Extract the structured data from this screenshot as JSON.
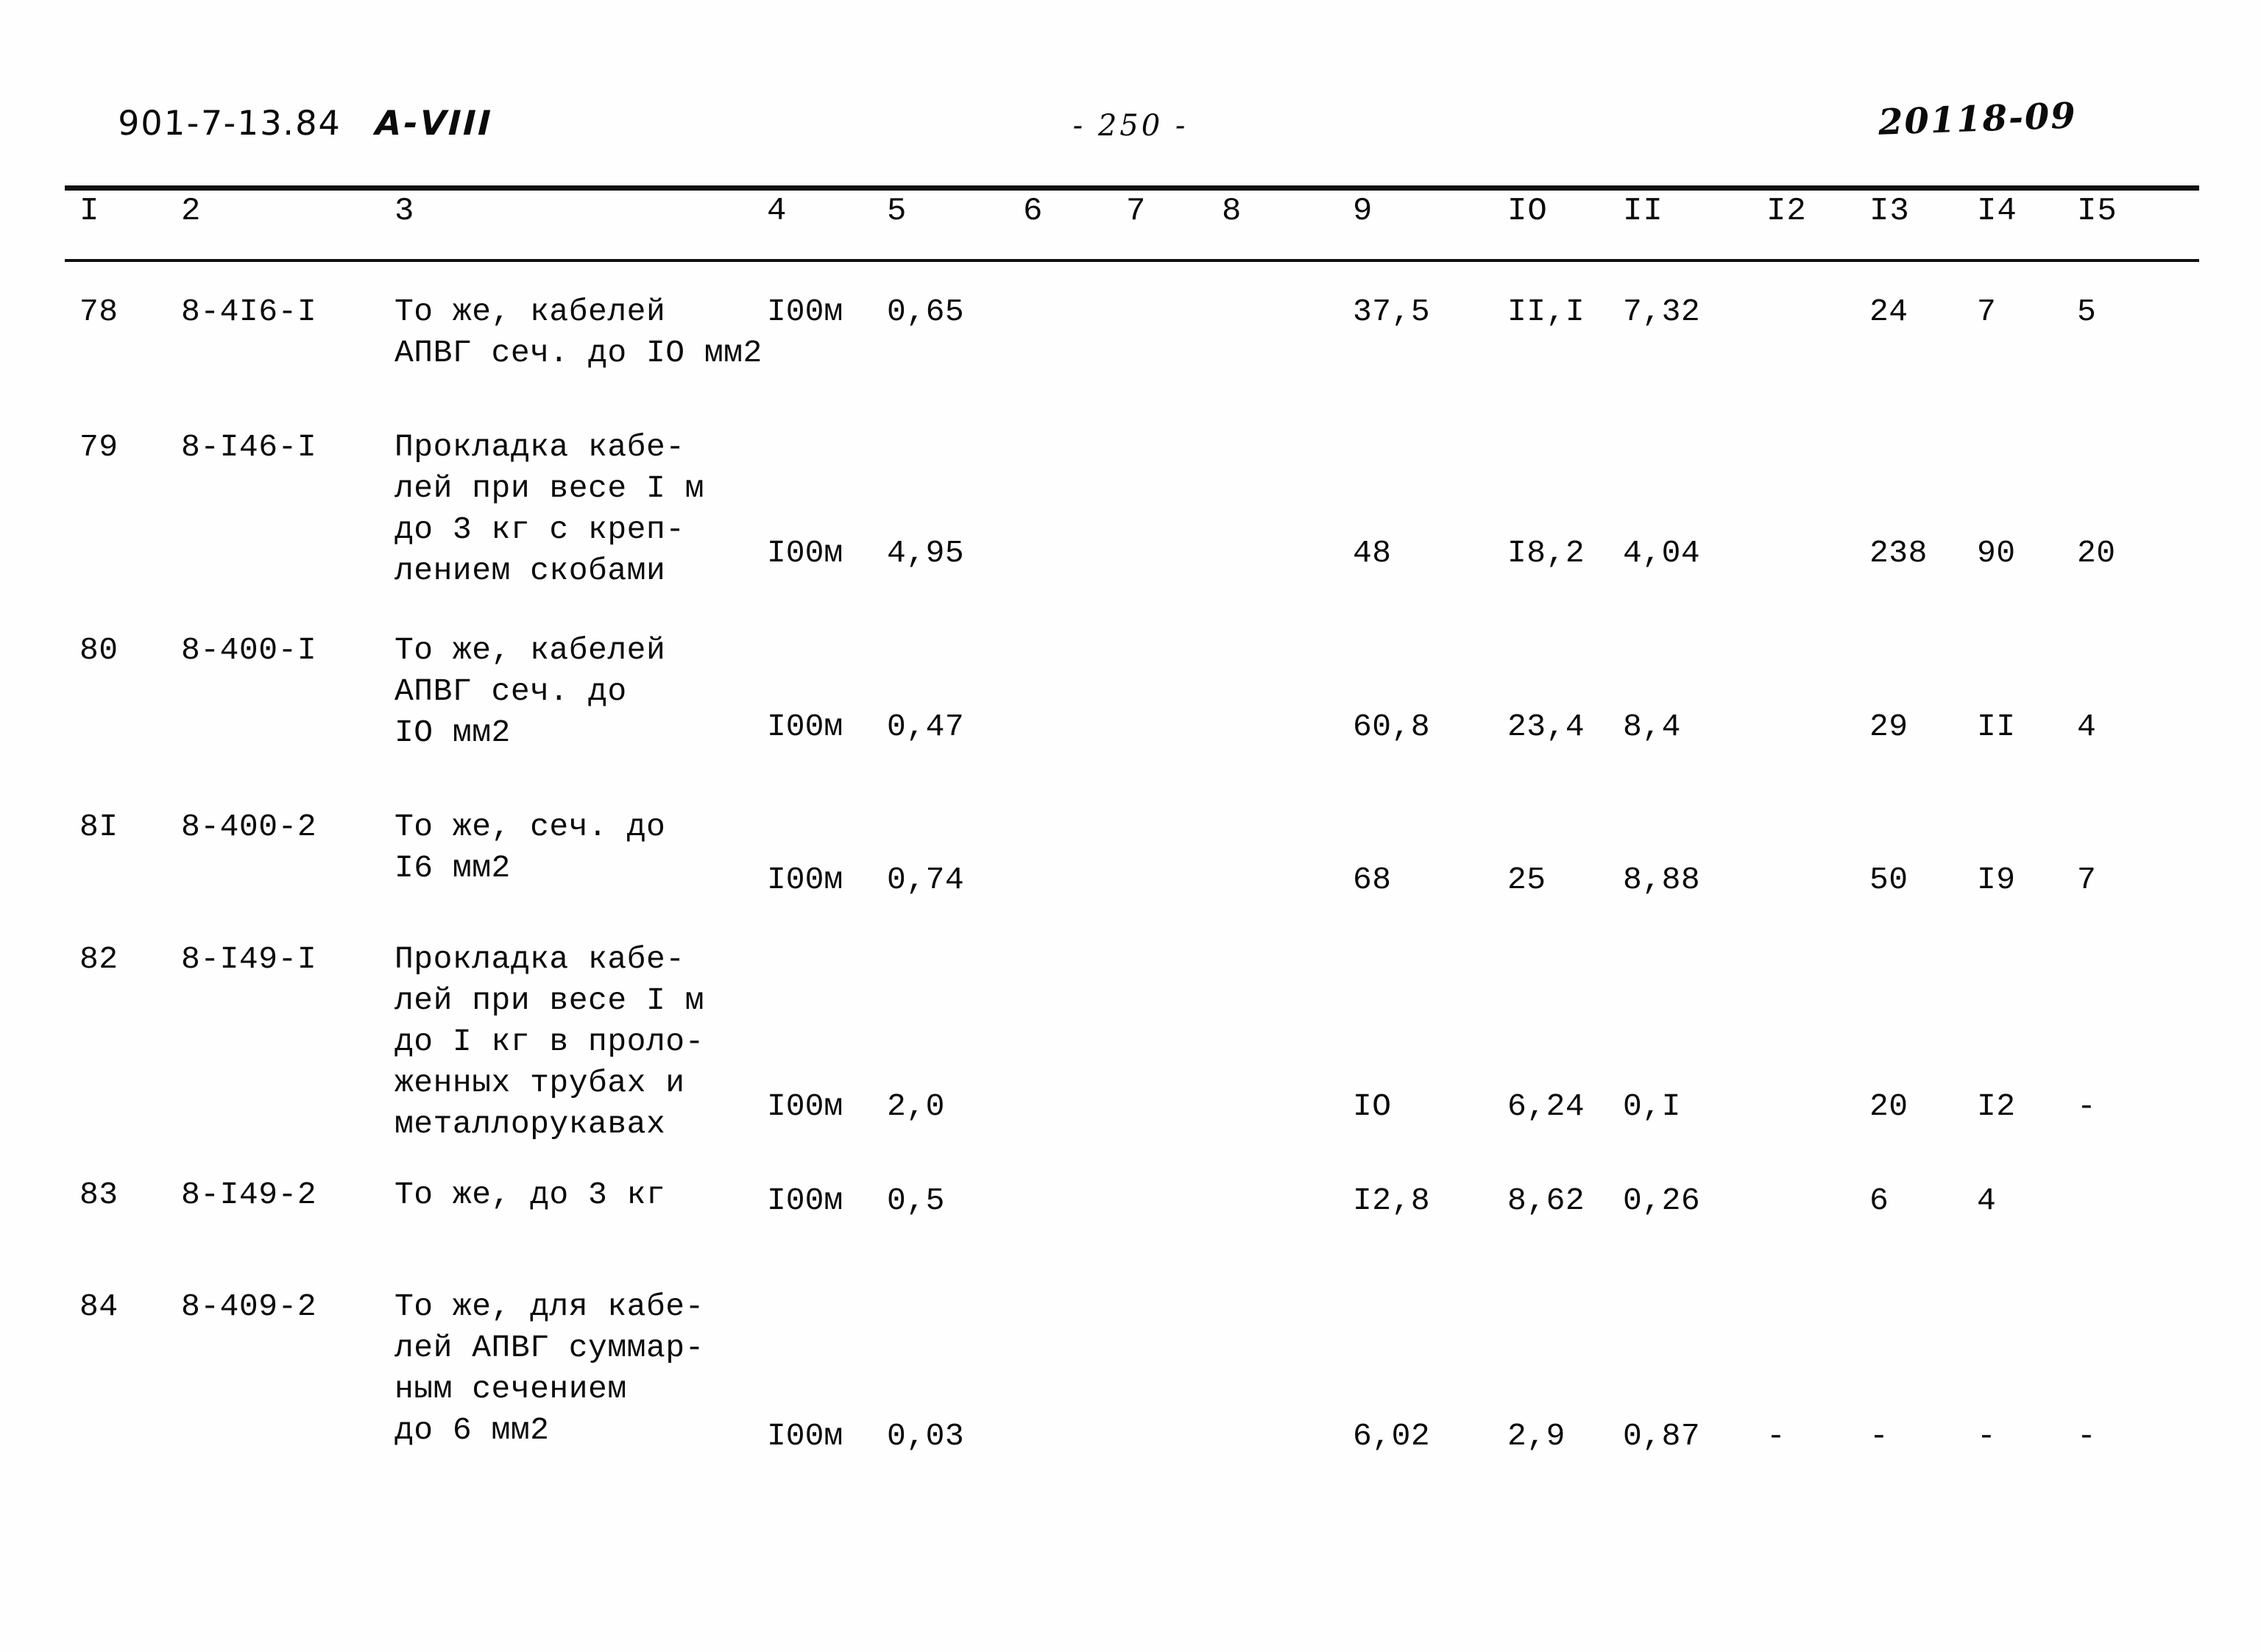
{
  "header": {
    "doc_code": "901-7-13.84",
    "doc_part": "А-VIII",
    "page_marker": "- 250 -",
    "archive_stamp": "20118-09"
  },
  "table": {
    "column_numbers": [
      "I",
      "2",
      "3",
      "4",
      "5",
      "6",
      "7",
      "8",
      "9",
      "IO",
      "II",
      "I2",
      "I3",
      "I4",
      "I5"
    ],
    "rows": [
      {
        "num": "78",
        "code": "8-4I6-I",
        "description": "То же, кабелей\nАПВГ сеч. до IO мм2",
        "unit": "I00м",
        "c5": "0,65",
        "c6": "",
        "c7": "",
        "c8": "",
        "c9": "37,5",
        "c10": "II,I",
        "c11": "7,32",
        "c12": "",
        "c13": "24",
        "c14": "7",
        "c15": "5"
      },
      {
        "num": "79",
        "code": "8-I46-I",
        "description": "Прокладка кабе-\nлей при весе I м\nдо 3 кг с креп-\nлением скобами",
        "unit": "I00м",
        "c5": "4,95",
        "c6": "",
        "c7": "",
        "c8": "",
        "c9": "48",
        "c10": "I8,2",
        "c11": "4,04",
        "c12": "",
        "c13": "238",
        "c14": "90",
        "c15": "20"
      },
      {
        "num": "80",
        "code": "8-400-I",
        "description": "То же, кабелей\nАПВГ сеч. до\nIO мм2",
        "unit": "I00м",
        "c5": "0,47",
        "c6": "",
        "c7": "",
        "c8": "",
        "c9": "60,8",
        "c10": "23,4",
        "c11": "8,4",
        "c12": "",
        "c13": "29",
        "c14": "II",
        "c15": "4"
      },
      {
        "num": "8I",
        "code": "8-400-2",
        "description": "То же, сеч. до\nI6 мм2",
        "unit": "I00м",
        "c5": "0,74",
        "c6": "",
        "c7": "",
        "c8": "",
        "c9": "68",
        "c10": "25",
        "c11": "8,88",
        "c12": "",
        "c13": "50",
        "c14": "I9",
        "c15": "7"
      },
      {
        "num": "82",
        "code": "8-I49-I",
        "description": "Прокладка кабе-\nлей при весе I м\nдо I кг в проло-\nженных трубах и\nметаллорукавах",
        "unit": "I00м",
        "c5": "2,0",
        "c6": "",
        "c7": "",
        "c8": "",
        "c9": "IO",
        "c10": "6,24",
        "c11": "0,I",
        "c12": "",
        "c13": "20",
        "c14": "I2",
        "c15": "-"
      },
      {
        "num": "83",
        "code": "8-I49-2",
        "description": "То же, до 3 кг",
        "unit": "I00м",
        "c5": "0,5",
        "c6": "",
        "c7": "",
        "c8": "",
        "c9": "I2,8",
        "c10": "8,62",
        "c11": "0,26",
        "c12": "",
        "c13": "6",
        "c14": "4",
        "c15": ""
      },
      {
        "num": "84",
        "code": "8-409-2",
        "description": "То же, для кабе-\nлей АПВГ суммар-\nным сечением\nдо 6 мм2",
        "unit": "I00м",
        "c5": "0,03",
        "c6": "",
        "c7": "",
        "c8": "",
        "c9": "6,02",
        "c10": "2,9",
        "c11": "0,87",
        "c12": "-",
        "c13": "-",
        "c14": "-",
        "c15": "-"
      }
    ]
  }
}
